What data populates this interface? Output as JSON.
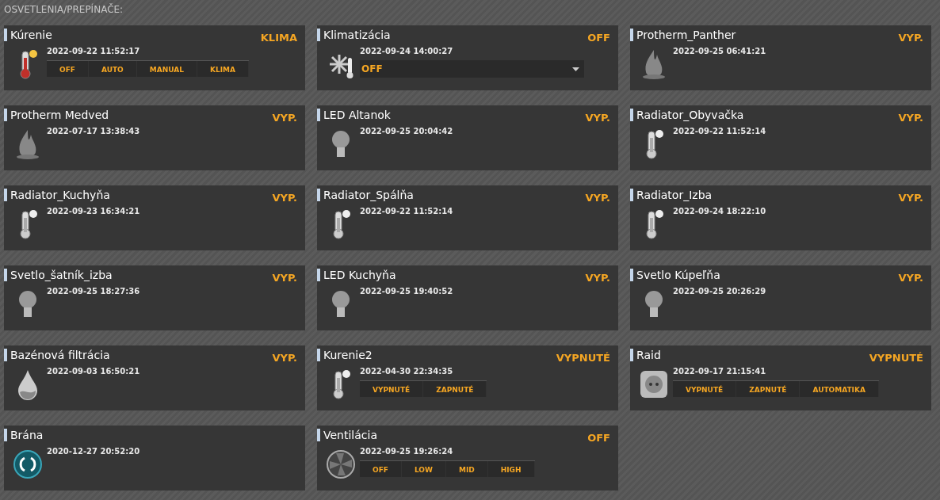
{
  "heading": "OSVETLENIA/PREPÍNAČE:",
  "devices": [
    {
      "name": "Kúrenie",
      "status": "KLIMA",
      "time": "2022-09-22 11:52:17",
      "kind": "thermo-hot",
      "control": {
        "kind": "buttons",
        "options": [
          "OFF",
          "AUTO",
          "MANUAL",
          "KLIMA"
        ]
      }
    },
    {
      "name": "Klimatizácia",
      "status": "OFF",
      "time": "2022-09-24 14:00:27",
      "kind": "snow",
      "control": {
        "kind": "dropdown",
        "value": "OFF"
      }
    },
    {
      "name": "Protherm_Panther",
      "status": "VYP.",
      "time": "2022-09-25 06:41:21",
      "kind": "flame"
    },
    {
      "name": "Protherm Medved",
      "status": "VYP.",
      "time": "2022-07-17 13:38:43",
      "kind": "flame"
    },
    {
      "name": "LED Altanok",
      "status": "VYP.",
      "time": "2022-09-25 20:04:42",
      "kind": "bulb"
    },
    {
      "name": "Radiator_Obyvačka",
      "status": "VYP.",
      "time": "2022-09-22 11:52:14",
      "kind": "thermo"
    },
    {
      "name": "Radiator_Kuchyňa",
      "status": "VYP.",
      "time": "2022-09-23 16:34:21",
      "kind": "thermo"
    },
    {
      "name": "Radiator_Spálňa",
      "status": "VYP.",
      "time": "2022-09-22 11:52:14",
      "kind": "thermo"
    },
    {
      "name": "Radiator_Izba",
      "status": "VYP.",
      "time": "2022-09-24 18:22:10",
      "kind": "thermo"
    },
    {
      "name": "Svetlo_šatník_izba",
      "status": "VYP.",
      "time": "2022-09-25 18:27:36",
      "kind": "bulb"
    },
    {
      "name": "LED Kuchyňa",
      "status": "VYP.",
      "time": "2022-09-25 19:40:52",
      "kind": "bulb"
    },
    {
      "name": "Svetlo Kúpeľňa",
      "status": "VYP.",
      "time": "2022-09-25 20:26:29",
      "kind": "bulb"
    },
    {
      "name": "Bazénová filtrácia",
      "status": "VYP.",
      "time": "2022-09-03 16:50:21",
      "kind": "drop"
    },
    {
      "name": "Kurenie2",
      "status": "VYPNUTÉ",
      "time": "2022-04-30 22:34:35",
      "kind": "thermo",
      "control": {
        "kind": "buttons",
        "options": [
          "VYPNUTÉ",
          "ZAPNUTÉ"
        ]
      }
    },
    {
      "name": "Raid",
      "status": "VYPNUTÉ",
      "time": "2022-09-17 21:15:41",
      "kind": "socket",
      "control": {
        "kind": "buttons",
        "options": [
          "VYPNUTÉ",
          "ZAPNUTÉ",
          "AUTOMATIKA"
        ]
      }
    },
    {
      "name": "Brána",
      "time": "2020-12-27 20:52:20",
      "kind": "gate"
    },
    {
      "name": "Ventilácia",
      "status": "OFF",
      "time": "2022-09-25 19:26:24",
      "kind": "fan",
      "control": {
        "kind": "buttons",
        "options": [
          "OFF",
          "LOW",
          "MID",
          "HIGH"
        ]
      }
    }
  ]
}
